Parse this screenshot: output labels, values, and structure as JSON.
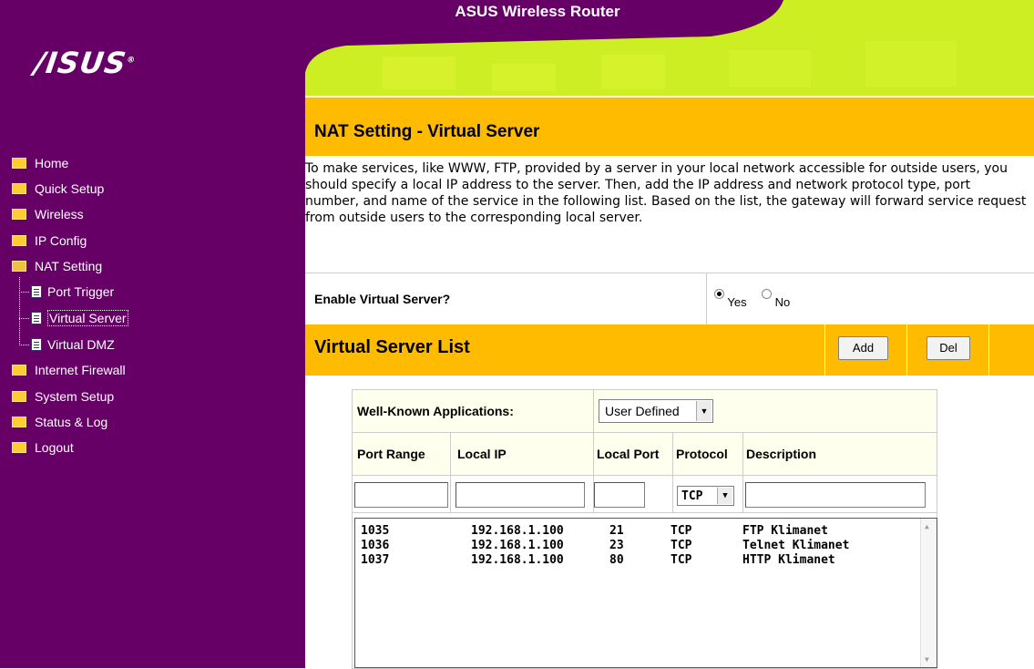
{
  "header": {
    "title": "ASUS Wireless Router",
    "logo_text": "/ISUS"
  },
  "sidebar": {
    "items": [
      {
        "label": "Home",
        "icon": "folder-icon"
      },
      {
        "label": "Quick Setup",
        "icon": "folder-icon"
      },
      {
        "label": "Wireless",
        "icon": "folder-icon"
      },
      {
        "label": "IP Config",
        "icon": "folder-icon"
      },
      {
        "label": "NAT Setting",
        "icon": "folder-open-icon"
      },
      {
        "label": "Port Trigger",
        "icon": "document-icon"
      },
      {
        "label": "Virtual Server",
        "icon": "document-icon",
        "selected": true
      },
      {
        "label": "Virtual DMZ",
        "icon": "document-icon"
      },
      {
        "label": "Internet Firewall",
        "icon": "folder-icon"
      },
      {
        "label": "System Setup",
        "icon": "folder-icon"
      },
      {
        "label": "Status & Log",
        "icon": "folder-icon"
      },
      {
        "label": "Logout",
        "icon": "folder-icon"
      }
    ]
  },
  "main": {
    "title": "NAT Setting - Virtual Server",
    "description": "To make services, like WWW, FTP, provided by a server in your local network accessible for outside users, you should specify a local IP address to the server. Then, add the IP address and network protocol type, port number, and name of the service in the following list. Based on the list, the gateway will forward service request from outside users to the corresponding local server.",
    "enable_label": "Enable Virtual Server?",
    "enable_yes": "Yes",
    "enable_no": "No",
    "enable_value": "Yes",
    "list_title": "Virtual Server List",
    "add_label": "Add",
    "del_label": "Del"
  },
  "table": {
    "apps_label": "Well-Known Applications:",
    "apps_value": "User Defined",
    "columns": [
      "Port Range",
      "Local IP",
      "Local Port",
      "Protocol",
      "Description"
    ],
    "protocol_value": "TCP",
    "rows": [
      {
        "port_range": "1035",
        "local_ip": "192.168.1.100",
        "local_port": "21",
        "protocol": "TCP",
        "description": "FTP Klimanet"
      },
      {
        "port_range": "1036",
        "local_ip": "192.168.1.100",
        "local_port": "23",
        "protocol": "TCP",
        "description": "Telnet Klimanet"
      },
      {
        "port_range": "1037",
        "local_ip": "192.168.1.100",
        "local_port": "80",
        "protocol": "TCP",
        "description": "HTTP Klimanet"
      }
    ]
  },
  "colors": {
    "sidebar": "#660066",
    "accent_yellow": "#ffbb00",
    "header_green": "#ccee22"
  }
}
